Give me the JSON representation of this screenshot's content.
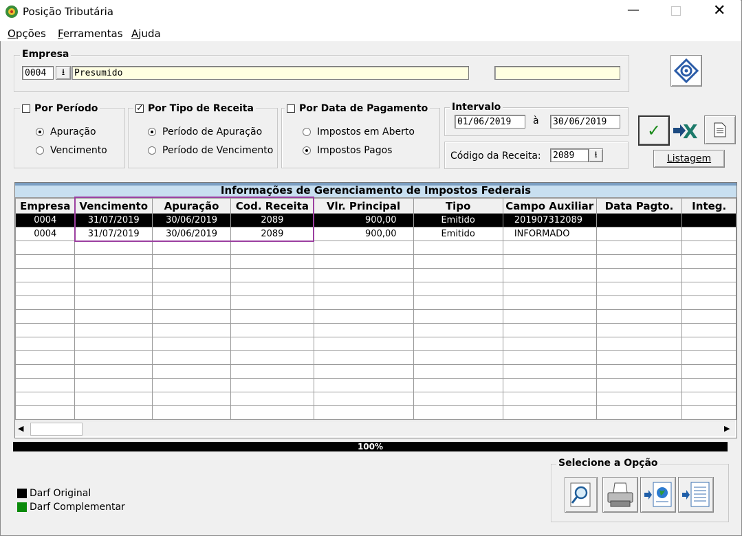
{
  "window": {
    "title": "Posição Tributária"
  },
  "menu": [
    "Opções",
    "Ferramentas",
    "Ajuda"
  ],
  "empresa": {
    "label": "Empresa",
    "code": "0004",
    "name": "Presumido",
    "extra": ""
  },
  "por_periodo": {
    "label": "Por Período",
    "checked": false,
    "options": [
      "Apuração",
      "Vencimento"
    ],
    "selected": 0
  },
  "por_tipo": {
    "label": "Por Tipo de Receita",
    "checked": true,
    "options": [
      "Período de Apuração",
      "Período de Vencimento"
    ],
    "selected": 0
  },
  "por_data": {
    "label": "Por Data de Pagamento",
    "checked": false,
    "options": [
      "Impostos em Aberto",
      "Impostos Pagos"
    ],
    "selected": 1
  },
  "intervalo": {
    "label": "Intervalo",
    "from": "01/06/2019",
    "sep": "à",
    "to": "30/06/2019"
  },
  "codigo": {
    "label": "Código da Receita:",
    "value": "2089"
  },
  "listagem_label": "Listagem",
  "grid": {
    "title": "Informações de Gerenciamento de Impostos Federais",
    "columns": [
      "Empresa",
      "Vencimento",
      "Apuração",
      "Cod. Receita",
      "Vlr. Principal",
      "Tipo",
      "Campo Auxiliar",
      "Data Pagto.",
      "Integ."
    ],
    "rows": [
      [
        "0004",
        "31/07/2019",
        "30/06/2019",
        "2089",
        "900,00",
        "Emitido",
        "201907312089",
        "",
        ""
      ],
      [
        "0004",
        "31/07/2019",
        "30/06/2019",
        "2089",
        "900,00",
        "Emitido",
        "INFORMADO",
        "",
        ""
      ]
    ],
    "selected_row": 0,
    "highlight_color": "#9b3fa0"
  },
  "progress": {
    "value": 100,
    "label": "100%"
  },
  "legend": [
    {
      "label": "Darf Original",
      "color": "#000000"
    },
    {
      "label": "Darf Complementar",
      "color": "#0a8a0a"
    }
  ],
  "selecione": {
    "label": "Selecione a Opção",
    "buttons": [
      "magnifier-icon",
      "printer-icon",
      "export-web-icon",
      "export-document-icon"
    ]
  }
}
